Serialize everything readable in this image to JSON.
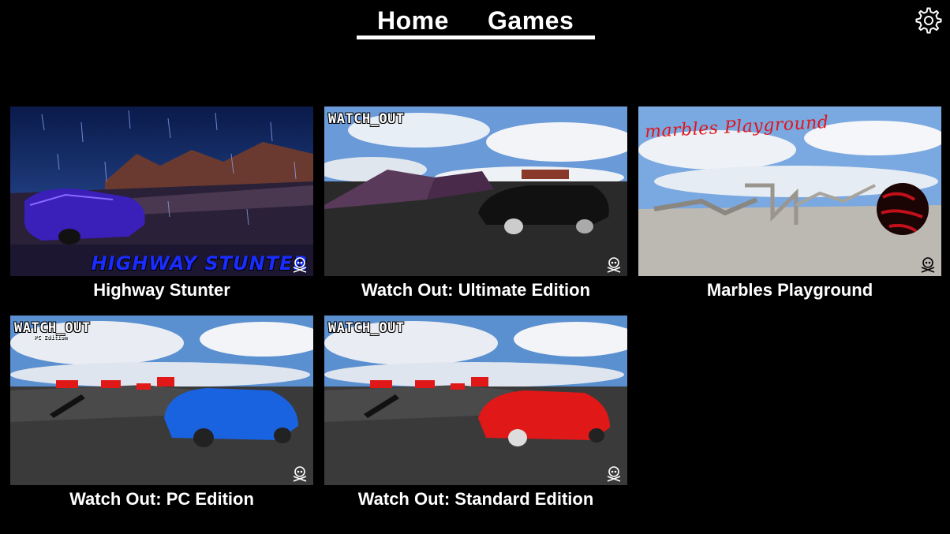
{
  "nav": {
    "home_label": "Home",
    "games_label": "Games",
    "settings_icon": "gear-icon"
  },
  "games": [
    {
      "title": "Highway Stunter",
      "logo_text": "HIGHWAY STUNTER",
      "car_color": "#3a1fb8"
    },
    {
      "title": "Watch Out: Ultimate Edition",
      "logo_text": "WATCH_OUT",
      "car_color": "#111111"
    },
    {
      "title": "Marbles Playground",
      "logo_text": "marbles Playground",
      "ball_color": "#c0101a"
    },
    {
      "title": "Watch Out: PC Edition",
      "logo_text": "WATCH_OUT",
      "logo_sub": "PC Edition",
      "car_color": "#1a63e0"
    },
    {
      "title": "Watch Out: Standard Edition",
      "logo_text": "WATCH_OUT",
      "car_color": "#e01818"
    }
  ],
  "colors": {
    "background": "#000000",
    "text": "#ffffff"
  }
}
